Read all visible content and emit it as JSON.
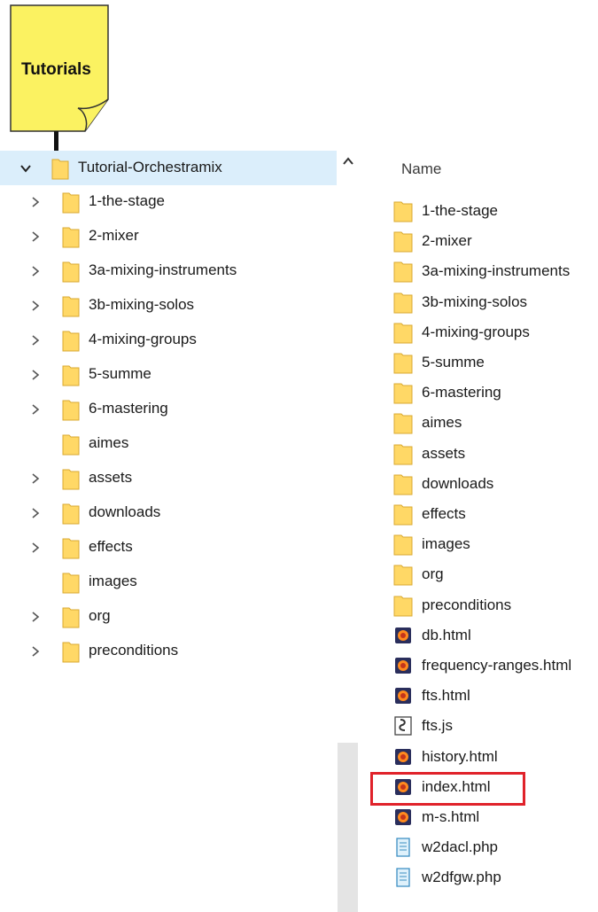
{
  "callout": {
    "label": "Tutorials",
    "color": "#fbf261"
  },
  "tree": {
    "root": {
      "label": "Tutorial-Orchestramix",
      "expanded": true,
      "selected": true
    },
    "items": [
      {
        "label": "1-the-stage",
        "expandable": true
      },
      {
        "label": "2-mixer",
        "expandable": true
      },
      {
        "label": "3a-mixing-instruments",
        "expandable": true
      },
      {
        "label": "3b-mixing-solos",
        "expandable": true
      },
      {
        "label": "4-mixing-groups",
        "expandable": true
      },
      {
        "label": "5-summe",
        "expandable": true
      },
      {
        "label": "6-mastering",
        "expandable": true
      },
      {
        "label": "aimes",
        "expandable": false
      },
      {
        "label": "assets",
        "expandable": true
      },
      {
        "label": "downloads",
        "expandable": true
      },
      {
        "label": "effects",
        "expandable": true
      },
      {
        "label": "images",
        "expandable": false
      },
      {
        "label": "org",
        "expandable": true
      },
      {
        "label": "preconditions",
        "expandable": true
      }
    ]
  },
  "list": {
    "column_header": "Name",
    "items": [
      {
        "label": "1-the-stage",
        "icon": "folder-icon"
      },
      {
        "label": "2-mixer",
        "icon": "folder-icon"
      },
      {
        "label": "3a-mixing-instruments",
        "icon": "folder-icon"
      },
      {
        "label": "3b-mixing-solos",
        "icon": "folder-icon"
      },
      {
        "label": "4-mixing-groups",
        "icon": "folder-icon"
      },
      {
        "label": "5-summe",
        "icon": "folder-icon"
      },
      {
        "label": "6-mastering",
        "icon": "folder-icon"
      },
      {
        "label": "aimes",
        "icon": "folder-icon"
      },
      {
        "label": "assets",
        "icon": "folder-icon"
      },
      {
        "label": "downloads",
        "icon": "folder-icon"
      },
      {
        "label": "effects",
        "icon": "folder-icon"
      },
      {
        "label": "images",
        "icon": "folder-icon"
      },
      {
        "label": "org",
        "icon": "folder-icon"
      },
      {
        "label": "preconditions",
        "icon": "folder-icon"
      },
      {
        "label": "db.html",
        "icon": "html-file-icon"
      },
      {
        "label": "frequency-ranges.html",
        "icon": "html-file-icon"
      },
      {
        "label": "fts.html",
        "icon": "html-file-icon"
      },
      {
        "label": "fts.js",
        "icon": "script-file-icon"
      },
      {
        "label": "history.html",
        "icon": "html-file-icon"
      },
      {
        "label": "index.html",
        "icon": "html-file-icon",
        "highlighted": true
      },
      {
        "label": "m-s.html",
        "icon": "html-file-icon"
      },
      {
        "label": "w2dacl.php",
        "icon": "php-file-icon"
      },
      {
        "label": "w2dfgw.php",
        "icon": "php-file-icon"
      }
    ]
  },
  "colors": {
    "selection": "#dbeefb",
    "folder": "#ffd866",
    "highlight_box": "#e0222a"
  }
}
